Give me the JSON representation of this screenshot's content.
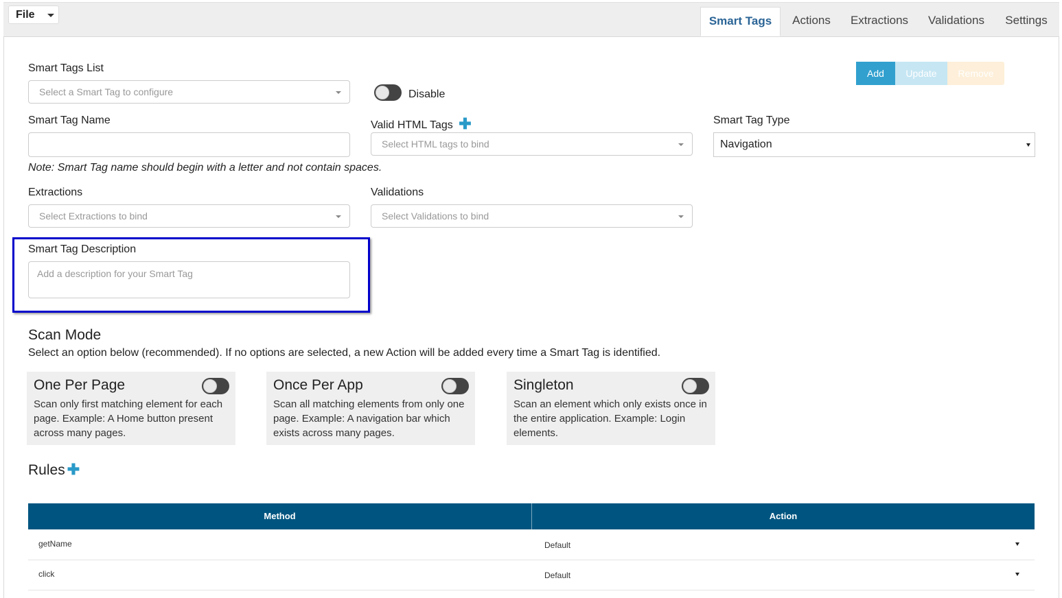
{
  "menu": {
    "file_label": "File"
  },
  "tabs": [
    {
      "label": "Smart Tags",
      "active": true
    },
    {
      "label": "Actions"
    },
    {
      "label": "Extractions"
    },
    {
      "label": "Validations"
    },
    {
      "label": "Settings"
    }
  ],
  "smart_tags_list": {
    "label": "Smart Tags List",
    "placeholder": "Select a Smart Tag to configure"
  },
  "disable_toggle": {
    "label": "Disable"
  },
  "buttons": {
    "add": "Add",
    "update": "Update",
    "remove": "Remove"
  },
  "smart_tag_name": {
    "label": "Smart Tag Name",
    "value": "",
    "note": "Note: Smart Tag name should begin with a letter and not contain spaces."
  },
  "valid_html_tags": {
    "label": "Valid HTML Tags",
    "placeholder": "Select HTML tags to bind"
  },
  "smart_tag_type": {
    "label": "Smart Tag Type",
    "value": "Navigation"
  },
  "extractions": {
    "label": "Extractions",
    "placeholder": "Select Extractions to bind"
  },
  "validations": {
    "label": "Validations",
    "placeholder": "Select Validations to bind"
  },
  "description": {
    "label": "Smart Tag Description",
    "placeholder": "Add a description for your Smart Tag"
  },
  "scan_mode": {
    "title": "Scan Mode",
    "subtitle": "Select an option below (recommended). If no options are selected, a new Action will be added every time a Smart Tag is identified.",
    "options": [
      {
        "title": "One Per Page",
        "desc": "Scan only first matching element for each page. Example: A Home button present across many pages."
      },
      {
        "title": "Once Per App",
        "desc": "Scan all matching elements from only one page. Example: A navigation bar which exists across many pages."
      },
      {
        "title": "Singleton",
        "desc": "Scan an element which only exists once in the entire application. Example: Login elements."
      }
    ]
  },
  "rules": {
    "title": "Rules",
    "columns": [
      "Method",
      "Action"
    ],
    "rows": [
      {
        "method": "getName",
        "action": "Default"
      },
      {
        "method": "click",
        "action": "Default"
      }
    ]
  },
  "colors": {
    "accent": "#2a9ac8",
    "table_header": "#005580",
    "highlight_border": "#0000cc"
  }
}
